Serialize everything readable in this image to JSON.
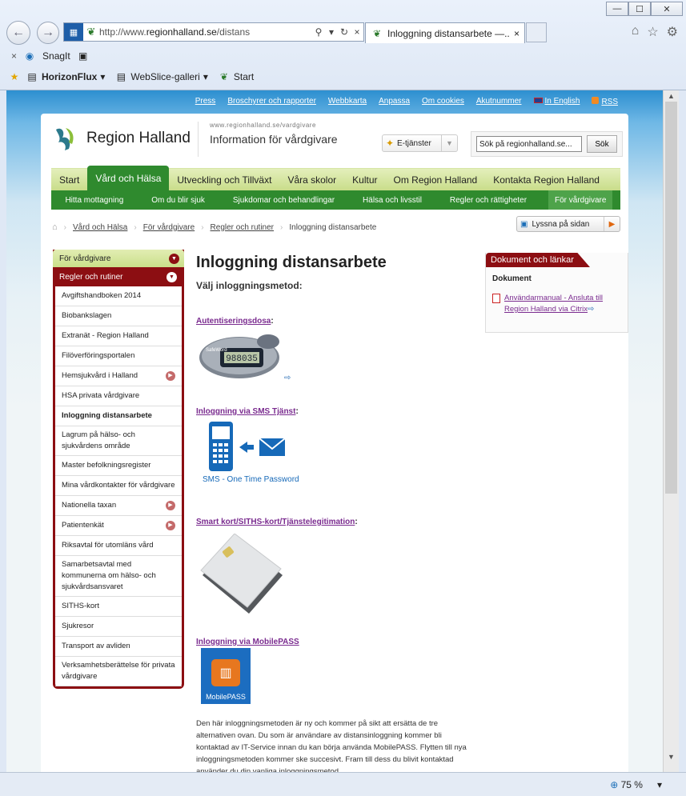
{
  "browser": {
    "window_controls": {
      "minimize": "—",
      "maximize": "☐",
      "close": "✕"
    },
    "back_glyph": "←",
    "forward_glyph": "→",
    "address": {
      "prefix": "http://www.",
      "domain": "regionhalland.se",
      "path": "/distans"
    },
    "tab_title": "Inloggning distansarbete —...",
    "tab_close": "×",
    "command_bar": {
      "close": "×",
      "snagit": "SnagIt"
    },
    "favorites": [
      {
        "label": "HorizonFlux",
        "bold": true
      },
      {
        "label": "WebSlice-galleri",
        "bold": false
      },
      {
        "label": "Start",
        "bold": false
      }
    ],
    "zoom": "75 %"
  },
  "toplinks": [
    "Press",
    "Broschyrer och rapporter",
    "Webbkarta",
    "Anpassa",
    "Om cookies",
    "Akutnummer",
    "In English",
    "RSS"
  ],
  "header": {
    "logo_text": "Region Halland",
    "site_url": "www.regionhalland.se/vardgivare",
    "site_title": "Information för vårdgivare",
    "etjanster": "E-tjänster",
    "search_placeholder": "Sök på regionhalland.se...",
    "search_button": "Sök"
  },
  "main_nav": [
    {
      "label": "Start",
      "active": false
    },
    {
      "label": "Vård och Hälsa",
      "active": true
    },
    {
      "label": "Utveckling och Tillväxt",
      "active": false
    },
    {
      "label": "Våra skolor",
      "active": false
    },
    {
      "label": "Kultur",
      "active": false
    },
    {
      "label": "Om Region Halland",
      "active": false
    },
    {
      "label": "Kontakta Region Halland",
      "active": false
    }
  ],
  "sub_nav": [
    {
      "label": "Hitta mottagning",
      "active": false
    },
    {
      "label": "Om du blir sjuk",
      "active": false
    },
    {
      "label": "Sjukdomar och behandlingar",
      "active": false
    },
    {
      "label": "Hälsa och livsstil",
      "active": false
    },
    {
      "label": "Regler och rättigheter",
      "active": false
    },
    {
      "label": "För vårdgivare",
      "active": true
    }
  ],
  "breadcrumb": [
    "Vård och Hälsa",
    "För vårdgivare",
    "Regler och rutiner",
    "Inloggning distansarbete"
  ],
  "listen_label": "Lyssna på sidan",
  "sidebar": {
    "head": "För vårdgivare",
    "section": "Regler och rutiner",
    "items": [
      {
        "label": "Avgiftshandboken 2014",
        "arrow": false,
        "current": false
      },
      {
        "label": "Biobankslagen",
        "arrow": false,
        "current": false
      },
      {
        "label": "Extranät - Region Halland",
        "arrow": false,
        "current": false
      },
      {
        "label": "Filöverföringsportalen",
        "arrow": false,
        "current": false
      },
      {
        "label": "Hemsjukvård i Halland",
        "arrow": true,
        "current": false
      },
      {
        "label": "HSA privata vårdgivare",
        "arrow": false,
        "current": false
      },
      {
        "label": "Inloggning distansarbete",
        "arrow": false,
        "current": true
      },
      {
        "label": "Lagrum på hälso- och sjukvårdens område",
        "arrow": false,
        "current": false
      },
      {
        "label": "Master befolkningsregister",
        "arrow": false,
        "current": false
      },
      {
        "label": "Mina vårdkontakter för vårdgivare",
        "arrow": false,
        "current": false
      },
      {
        "label": "Nationella taxan",
        "arrow": true,
        "current": false
      },
      {
        "label": "Patientenkät",
        "arrow": true,
        "current": false
      },
      {
        "label": "Riksavtal för utomläns vård",
        "arrow": false,
        "current": false
      },
      {
        "label": "Samarbetsavtal med kommunerna om hälso- och sjukvårdsansvaret",
        "arrow": false,
        "current": false
      },
      {
        "label": "SITHS-kort",
        "arrow": false,
        "current": false
      },
      {
        "label": "Sjukresor",
        "arrow": false,
        "current": false
      },
      {
        "label": "Transport av avliden",
        "arrow": false,
        "current": false
      },
      {
        "label": "Verksamhetsberättelse för privata vårdgivare",
        "arrow": false,
        "current": false
      }
    ]
  },
  "content": {
    "title": "Inloggning distansarbete",
    "subtitle": "Välj inloggningsmetod:",
    "methods": [
      {
        "label": "Autentiseringsdosa",
        "suffix": ":"
      },
      {
        "label": "Inloggning via SMS Tjänst",
        "suffix": ":"
      },
      {
        "label": "Smart kort/SITHS-kort/Tjänstelegitimation",
        "suffix": ":"
      },
      {
        "label": "Inloggning via MobilePASS",
        "suffix": ""
      }
    ],
    "token_brand": "SafeWord",
    "token_code": "988035",
    "sms_caption": "SMS - One Time Password",
    "mobilepass_caption": "MobilePASS",
    "paragraph": "Den här inloggningsmetoden är ny och kommer på sikt att ersätta de tre alternativen ovan. Du som är användare av distansinloggning kommer bli kontaktad av IT-Service innan du kan börja använda MobilePASS. Flytten till nya inloggningsmetoden kommer ske succesivt. Fram till dess du blivit kontaktad använder du din vanliga inloggningsmetod."
  },
  "rightbox": {
    "title": "Dokument och länkar",
    "label": "Dokument",
    "link": "Användarmanual - Ansluta till Region Halland via Citrix"
  },
  "colors": {
    "green": "#2f8a2e",
    "darkred": "#8c0e12",
    "link_purple": "#7a2b8f"
  }
}
